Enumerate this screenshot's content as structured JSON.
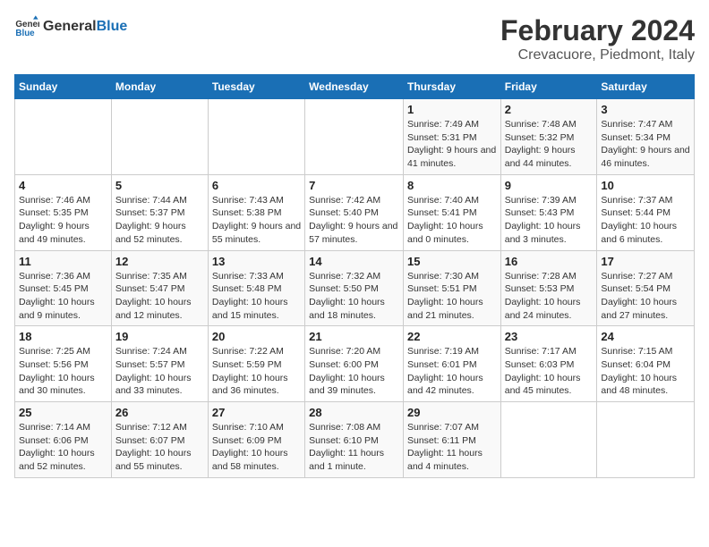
{
  "logo": {
    "text_general": "General",
    "text_blue": "Blue"
  },
  "title": "February 2024",
  "location": "Crevacuore, Piedmont, Italy",
  "days_of_week": [
    "Sunday",
    "Monday",
    "Tuesday",
    "Wednesday",
    "Thursday",
    "Friday",
    "Saturday"
  ],
  "weeks": [
    [
      {
        "num": "",
        "info": ""
      },
      {
        "num": "",
        "info": ""
      },
      {
        "num": "",
        "info": ""
      },
      {
        "num": "",
        "info": ""
      },
      {
        "num": "1",
        "info": "Sunrise: 7:49 AM\nSunset: 5:31 PM\nDaylight: 9 hours and 41 minutes."
      },
      {
        "num": "2",
        "info": "Sunrise: 7:48 AM\nSunset: 5:32 PM\nDaylight: 9 hours and 44 minutes."
      },
      {
        "num": "3",
        "info": "Sunrise: 7:47 AM\nSunset: 5:34 PM\nDaylight: 9 hours and 46 minutes."
      }
    ],
    [
      {
        "num": "4",
        "info": "Sunrise: 7:46 AM\nSunset: 5:35 PM\nDaylight: 9 hours and 49 minutes."
      },
      {
        "num": "5",
        "info": "Sunrise: 7:44 AM\nSunset: 5:37 PM\nDaylight: 9 hours and 52 minutes."
      },
      {
        "num": "6",
        "info": "Sunrise: 7:43 AM\nSunset: 5:38 PM\nDaylight: 9 hours and 55 minutes."
      },
      {
        "num": "7",
        "info": "Sunrise: 7:42 AM\nSunset: 5:40 PM\nDaylight: 9 hours and 57 minutes."
      },
      {
        "num": "8",
        "info": "Sunrise: 7:40 AM\nSunset: 5:41 PM\nDaylight: 10 hours and 0 minutes."
      },
      {
        "num": "9",
        "info": "Sunrise: 7:39 AM\nSunset: 5:43 PM\nDaylight: 10 hours and 3 minutes."
      },
      {
        "num": "10",
        "info": "Sunrise: 7:37 AM\nSunset: 5:44 PM\nDaylight: 10 hours and 6 minutes."
      }
    ],
    [
      {
        "num": "11",
        "info": "Sunrise: 7:36 AM\nSunset: 5:45 PM\nDaylight: 10 hours and 9 minutes."
      },
      {
        "num": "12",
        "info": "Sunrise: 7:35 AM\nSunset: 5:47 PM\nDaylight: 10 hours and 12 minutes."
      },
      {
        "num": "13",
        "info": "Sunrise: 7:33 AM\nSunset: 5:48 PM\nDaylight: 10 hours and 15 minutes."
      },
      {
        "num": "14",
        "info": "Sunrise: 7:32 AM\nSunset: 5:50 PM\nDaylight: 10 hours and 18 minutes."
      },
      {
        "num": "15",
        "info": "Sunrise: 7:30 AM\nSunset: 5:51 PM\nDaylight: 10 hours and 21 minutes."
      },
      {
        "num": "16",
        "info": "Sunrise: 7:28 AM\nSunset: 5:53 PM\nDaylight: 10 hours and 24 minutes."
      },
      {
        "num": "17",
        "info": "Sunrise: 7:27 AM\nSunset: 5:54 PM\nDaylight: 10 hours and 27 minutes."
      }
    ],
    [
      {
        "num": "18",
        "info": "Sunrise: 7:25 AM\nSunset: 5:56 PM\nDaylight: 10 hours and 30 minutes."
      },
      {
        "num": "19",
        "info": "Sunrise: 7:24 AM\nSunset: 5:57 PM\nDaylight: 10 hours and 33 minutes."
      },
      {
        "num": "20",
        "info": "Sunrise: 7:22 AM\nSunset: 5:59 PM\nDaylight: 10 hours and 36 minutes."
      },
      {
        "num": "21",
        "info": "Sunrise: 7:20 AM\nSunset: 6:00 PM\nDaylight: 10 hours and 39 minutes."
      },
      {
        "num": "22",
        "info": "Sunrise: 7:19 AM\nSunset: 6:01 PM\nDaylight: 10 hours and 42 minutes."
      },
      {
        "num": "23",
        "info": "Sunrise: 7:17 AM\nSunset: 6:03 PM\nDaylight: 10 hours and 45 minutes."
      },
      {
        "num": "24",
        "info": "Sunrise: 7:15 AM\nSunset: 6:04 PM\nDaylight: 10 hours and 48 minutes."
      }
    ],
    [
      {
        "num": "25",
        "info": "Sunrise: 7:14 AM\nSunset: 6:06 PM\nDaylight: 10 hours and 52 minutes."
      },
      {
        "num": "26",
        "info": "Sunrise: 7:12 AM\nSunset: 6:07 PM\nDaylight: 10 hours and 55 minutes."
      },
      {
        "num": "27",
        "info": "Sunrise: 7:10 AM\nSunset: 6:09 PM\nDaylight: 10 hours and 58 minutes."
      },
      {
        "num": "28",
        "info": "Sunrise: 7:08 AM\nSunset: 6:10 PM\nDaylight: 11 hours and 1 minute."
      },
      {
        "num": "29",
        "info": "Sunrise: 7:07 AM\nSunset: 6:11 PM\nDaylight: 11 hours and 4 minutes."
      },
      {
        "num": "",
        "info": ""
      },
      {
        "num": "",
        "info": ""
      }
    ]
  ]
}
